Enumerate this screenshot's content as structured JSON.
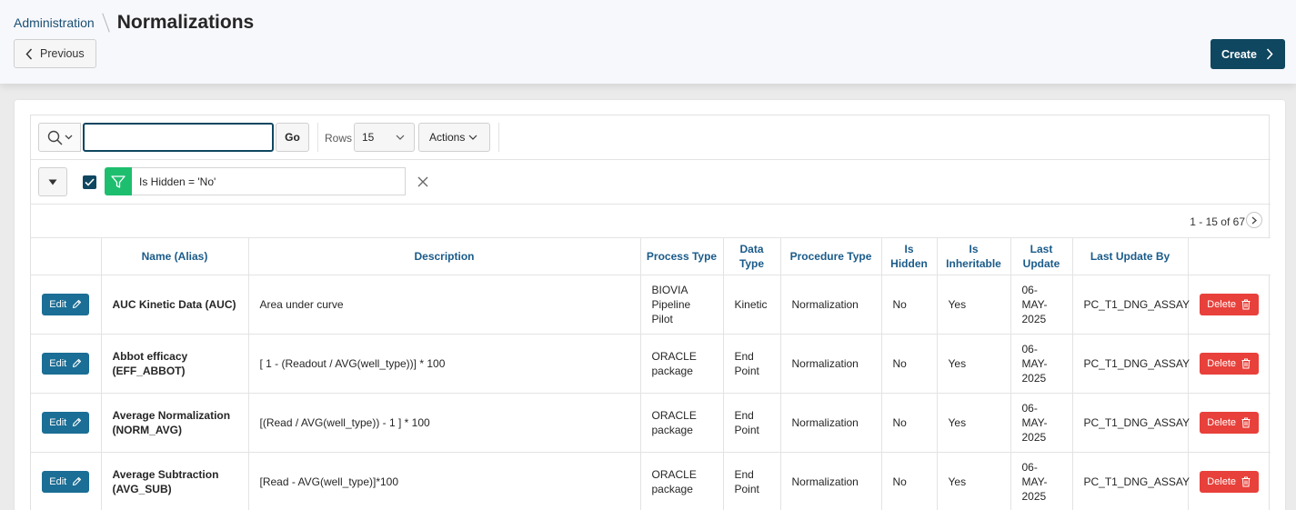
{
  "breadcrumb": {
    "parent": "Administration",
    "title": "Normalizations"
  },
  "buttons": {
    "previous": "Previous",
    "create": "Create"
  },
  "toolbar": {
    "search_value": "",
    "go_label": "Go",
    "rows_label": "Rows",
    "rows_value": "15",
    "actions_label": "Actions"
  },
  "filter": {
    "text": "Is Hidden = 'No'",
    "enabled": true
  },
  "pagination": {
    "text": "1 - 15 of 67"
  },
  "table": {
    "columns": [
      "Name (Alias)",
      "Description",
      "Process Type",
      "Data Type",
      "Procedure Type",
      "Is Hidden",
      "Is Inheritable",
      "Last Update",
      "Last Update By"
    ],
    "edit_label": "Edit",
    "delete_label": "Delete",
    "rows": [
      {
        "name": "AUC Kinetic Data (AUC)",
        "description": "Area under curve",
        "process_type": "BIOVIA Pipeline Pilot",
        "data_type": "Kinetic",
        "procedure_type": "Normalization",
        "is_hidden": "No",
        "is_inheritable": "Yes",
        "last_update": "06-MAY-2025",
        "last_update_by": "PC_T1_DNG_ASSAY"
      },
      {
        "name": "Abbot efficacy (EFF_ABBOT)",
        "description": "[ 1 - (Readout / AVG(well_type))] * 100",
        "process_type": "ORACLE package",
        "data_type": "End Point",
        "procedure_type": "Normalization",
        "is_hidden": "No",
        "is_inheritable": "Yes",
        "last_update": "06-MAY-2025",
        "last_update_by": "PC_T1_DNG_ASSAY"
      },
      {
        "name": "Average Normalization (NORM_AVG)",
        "description": "[(Read / AVG(well_type)) - 1 ] * 100",
        "process_type": "ORACLE package",
        "data_type": "End Point",
        "procedure_type": "Normalization",
        "is_hidden": "No",
        "is_inheritable": "Yes",
        "last_update": "06-MAY-2025",
        "last_update_by": "PC_T1_DNG_ASSAY"
      },
      {
        "name": "Average Subtraction (AVG_SUB)",
        "description": "[Read - AVG(well_type)]*100",
        "process_type": "ORACLE package",
        "data_type": "End Point",
        "procedure_type": "Normalization",
        "is_hidden": "No",
        "is_inheritable": "Yes",
        "last_update": "06-MAY-2025",
        "last_update_by": "PC_T1_DNG_ASSAY"
      }
    ]
  },
  "colors": {
    "primary": "#0f4660",
    "edit": "#1b6e95",
    "delete": "#e8403a",
    "filter": "#1ebe6f",
    "header_link": "#1a5b8a"
  }
}
